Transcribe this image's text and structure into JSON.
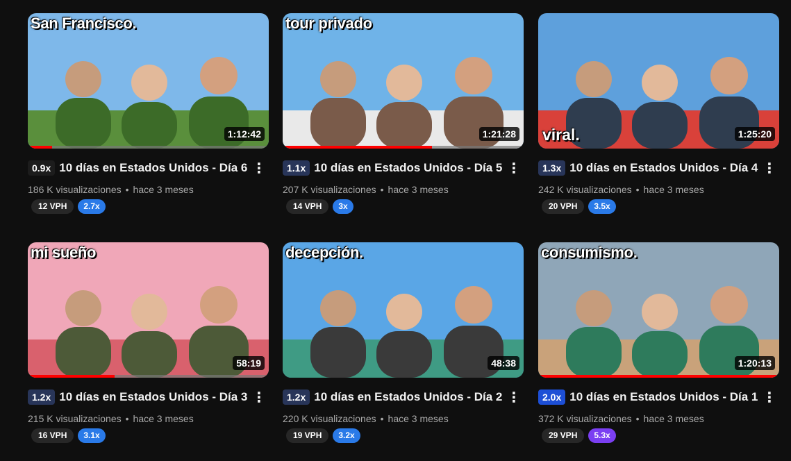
{
  "videos": [
    {
      "overlay_top": "San Francisco.",
      "overlay_bottom": "",
      "duration": "1:12:42",
      "progress": 0.1,
      "multiplier": "0.9x",
      "multiplier_style": "dark",
      "title": "10 días en Estados Unidos - Día 6",
      "views": "186 K visualizaciones",
      "age": "hace 3 meses",
      "vph": "12 VPH",
      "ratio": "2.7x",
      "ratio_style": "blue",
      "theme": [
        "#7eb8ea",
        "#5a8f3c",
        "#3c6b28"
      ]
    },
    {
      "overlay_top": "tour privado",
      "overlay_bottom": "",
      "duration": "1:21:28",
      "progress": 0.62,
      "multiplier": "1.1x",
      "multiplier_style": "navy",
      "title": "10 días en Estados Unidos - Día 5",
      "views": "207 K visualizaciones",
      "age": "hace 3 meses",
      "vph": "14 VPH",
      "ratio": "3x",
      "ratio_style": "blue",
      "theme": [
        "#6fb3e8",
        "#e9e9e9",
        "#7a5b4a"
      ]
    },
    {
      "overlay_top": "",
      "overlay_bottom": "viral.",
      "duration": "1:25:20",
      "progress": 0,
      "multiplier": "1.3x",
      "multiplier_style": "navy",
      "title": "10 días en Estados Unidos - Día 4",
      "views": "242 K visualizaciones",
      "age": "hace 3 meses",
      "vph": "20 VPH",
      "ratio": "3.5x",
      "ratio_style": "blue",
      "theme": [
        "#5ea0dc",
        "#d9413a",
        "#2f3d4f"
      ]
    },
    {
      "overlay_top": "mi sueño",
      "overlay_bottom": "",
      "duration": "58:19",
      "progress": 0.36,
      "multiplier": "1.2x",
      "multiplier_style": "navy",
      "title": "10 días en Estados Unidos - Día 3",
      "views": "215 K visualizaciones",
      "age": "hace 3 meses",
      "vph": "16 VPH",
      "ratio": "3.1x",
      "ratio_style": "blue",
      "theme": [
        "#f0a7b8",
        "#d9616d",
        "#4d5a38"
      ]
    },
    {
      "overlay_top": "decepción.",
      "overlay_bottom": "",
      "duration": "48:38",
      "progress": 0,
      "multiplier": "1.2x",
      "multiplier_style": "navy",
      "title": "10 días en Estados Unidos - Día 2",
      "views": "220 K visualizaciones",
      "age": "hace 3 meses",
      "vph": "19 VPH",
      "ratio": "3.2x",
      "ratio_style": "blue",
      "theme": [
        "#5aa6e6",
        "#3f9b84",
        "#3a3a3a"
      ]
    },
    {
      "overlay_top": "consumismo.",
      "overlay_bottom": "",
      "duration": "1:20:13",
      "progress": 1.0,
      "multiplier": "2.0x",
      "multiplier_style": "blue",
      "title": "10 días en Estados Unidos - Día 1",
      "views": "372 K visualizaciones",
      "age": "hace 3 meses",
      "vph": "29 VPH",
      "ratio": "5.3x",
      "ratio_style": "purple",
      "theme": [
        "#8fa6b8",
        "#c9a27a",
        "#2e7b5c"
      ]
    }
  ],
  "colors": {
    "progress": "#ff0000",
    "background": "#0f0f0f"
  },
  "icons": {
    "menu": "more-vert-icon"
  }
}
